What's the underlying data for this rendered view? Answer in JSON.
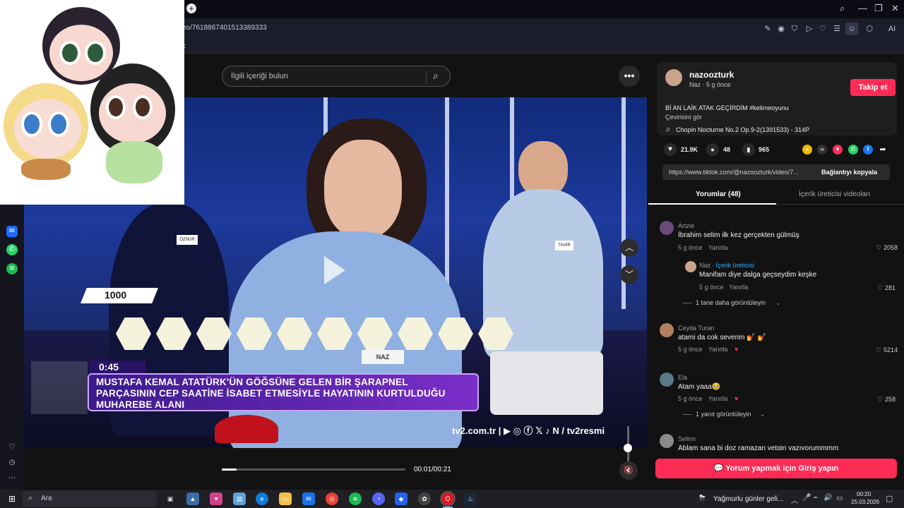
{
  "browser": {
    "url": "eo/7618867401513389333",
    "bookmark": "k",
    "toolbar_ai": "AI",
    "new_tab": "+"
  },
  "tiktok": {
    "search_placeholder": "İlgili içeriği bulun",
    "time_current_total": "00:01/00:21",
    "progress": 0.08,
    "video": {
      "score": "1000",
      "timer": "0:45",
      "question": "MUSTAFA KEMAL ATATÜRK'ÜN GÖĞSÜNE GELEN BİR ŞARAPNEL PARÇASININ CEP SAATİNE İSABET ETMESİYLE HAYATININ KURTULDUĞU MUHAREBE ALANI",
      "watermark": "tv2.com.tr | ▶ ◎ ⓕ 𝕏 ♪ N / tv2resmi",
      "name_tags": [
        "ÖZNUR",
        "TAHİR",
        "NAZ"
      ]
    }
  },
  "author": {
    "username": "nazoozturk",
    "subline": "Naz · 5 g önce",
    "follow_label": "Takip et",
    "caption": "Bİ AN LAİK ATAK GEÇİRDİM #kelimeoyunu",
    "translate_label": "Çevirisini gör",
    "music": "Chopin Nocturne No.2 Op.9-2(1391533) - 314P",
    "likes": "21.9K",
    "comments": "48",
    "saves": "965",
    "link": "https://www.tiktok.com/@nazoozturk/video/7...",
    "copy_link_label": "Bağlantıyı kopyala"
  },
  "tabs": {
    "comments": "Yorumlar (48)",
    "creator_videos": "İçerik üreticisi videoları"
  },
  "comments": [
    {
      "user": "Artzie",
      "text": "İbrahim selim ilk kez gerçekten gülmüş",
      "time": "5 g önce",
      "reply": "Yanıtla",
      "likes": "2058"
    },
    {
      "user": "Naz",
      "creator_badge": "· İçerik üreticisi",
      "text": "Manifam diye dalga geçseydim keşke",
      "time": "5 g önce",
      "reply": "Yanıtla",
      "likes": "281"
    },
    {
      "more": "1 tane daha görüntüleyin"
    },
    {
      "user": "Ceyda Turan",
      "text": "atami da cok severim 💅 💅",
      "time": "5 g önce",
      "reply": "Yanıtla",
      "likes": "5214"
    },
    {
      "user": "Ela",
      "text": "Atam yaaa🥹",
      "time": "5 g önce",
      "reply": "Yanıtla",
      "likes": "258"
    },
    {
      "more": "1 yanıt görüntüleyin"
    },
    {
      "user": "Selinn",
      "text": "Ablam sana bi doz ramazan yetgin yazıyorummmm"
    }
  ],
  "comment_button": "Yorum yapmak için Giriş yapın",
  "taskbar": {
    "search": "Ara",
    "weather": "Yağmurlu günler geli...",
    "time": "00:20",
    "date": "25.03.2026"
  },
  "colors": {
    "accent": "#fe2c55",
    "creator": "#2bb0ff"
  }
}
